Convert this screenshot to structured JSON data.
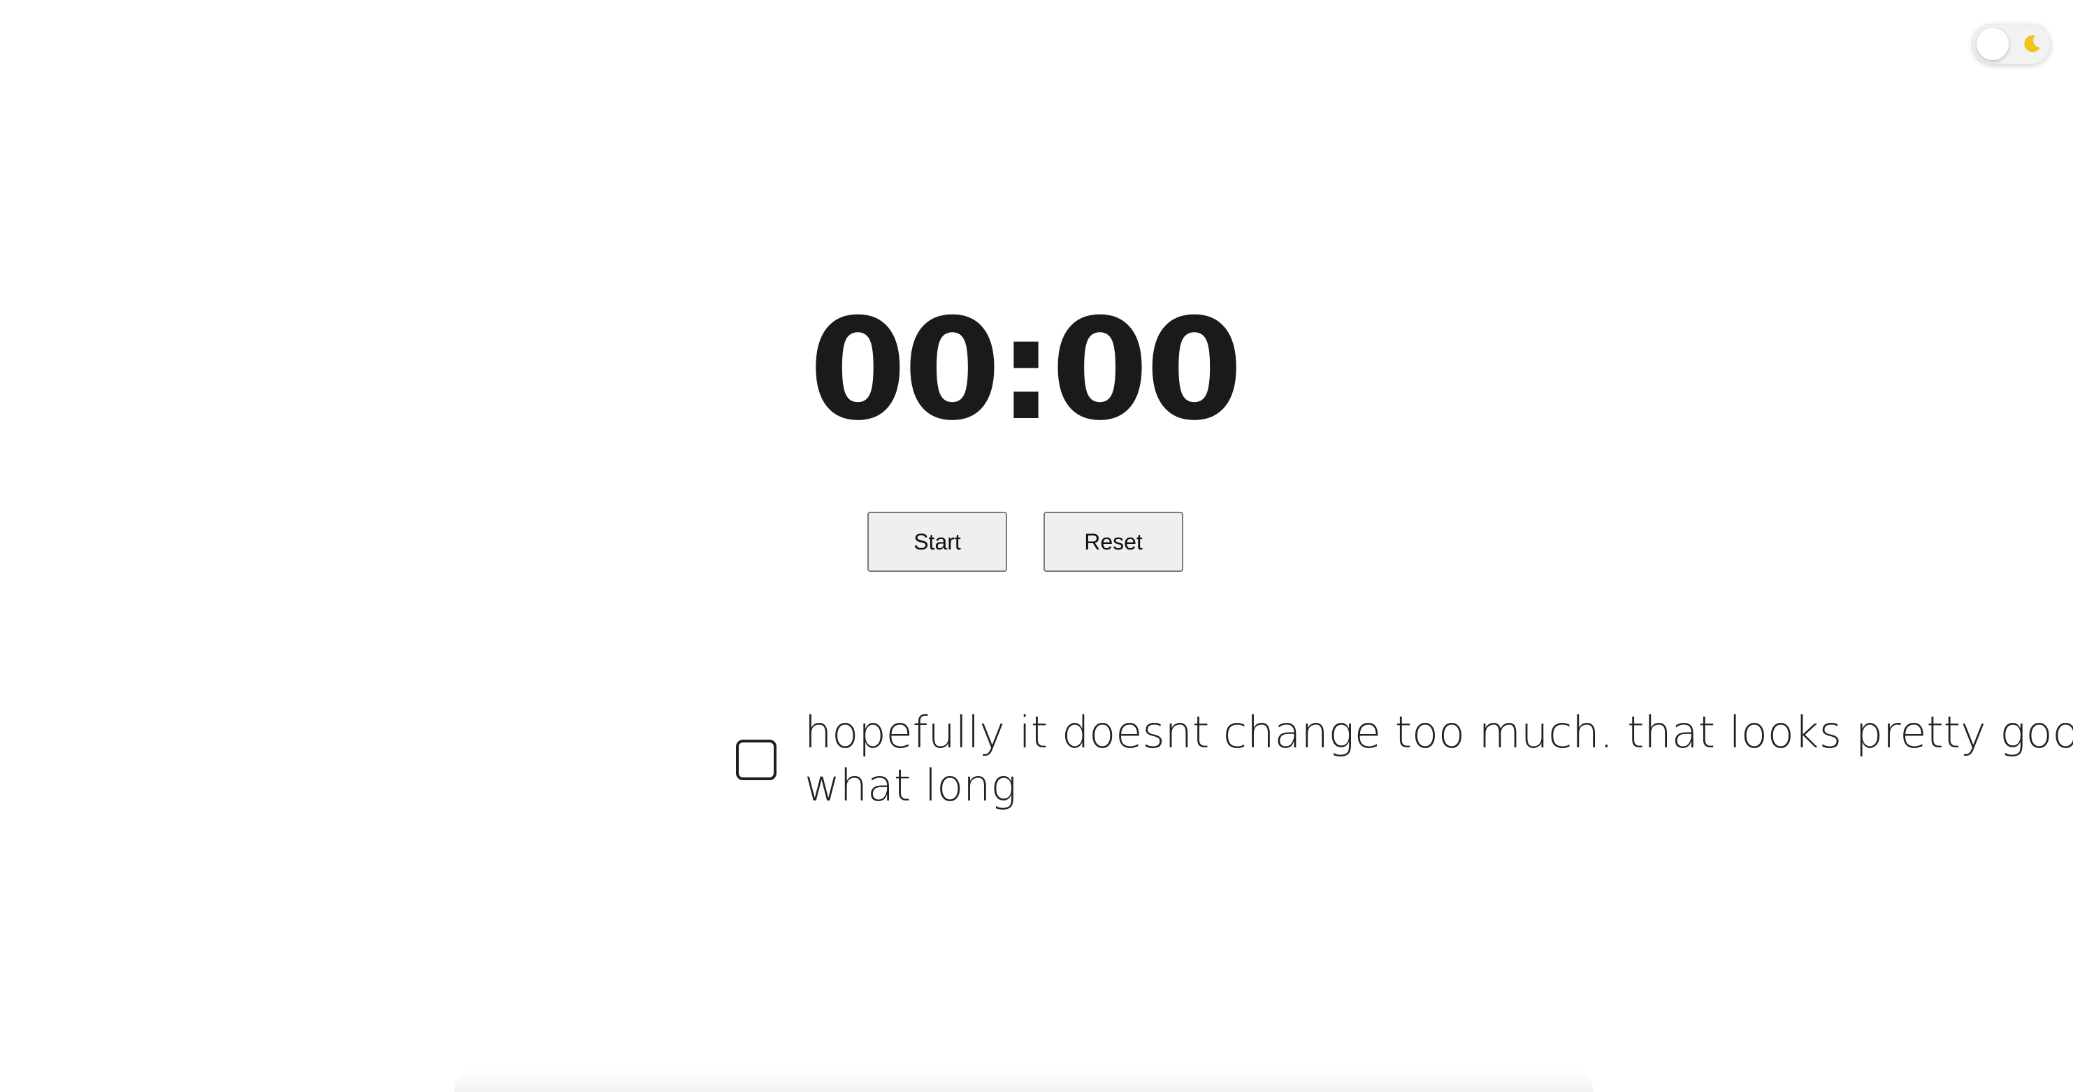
{
  "theme_toggle": {
    "icon": "moon-icon",
    "state": "off"
  },
  "timer": {
    "display": "00:00"
  },
  "controls": {
    "start_label": "Start",
    "reset_label": "Reset"
  },
  "tasks": [
    {
      "checked": false,
      "text": "hopefully it doesnt change too much. that looks pretty good. what long"
    }
  ],
  "colors": {
    "background": "#ffffff",
    "text": "#1a1a1a",
    "button_bg": "#efefef",
    "moon": "#f0c419"
  }
}
